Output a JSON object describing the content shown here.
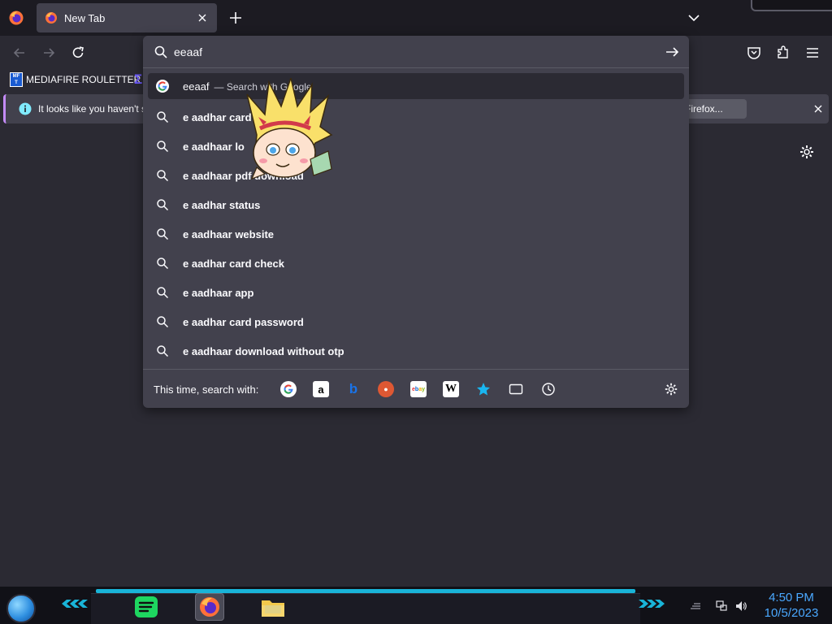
{
  "browser": {
    "tab": {
      "title": "New Tab"
    }
  },
  "bookmarks": {
    "items": [
      {
        "label": "MEDIAFIRE ROULETTER",
        "icon_text": "MF\nT"
      }
    ]
  },
  "notification": {
    "text": "It looks like you haven't s",
    "button_label": "h Firefox..."
  },
  "urlbar": {
    "input_value": "eeaaf",
    "results": [
      {
        "text": "eeaaf",
        "sub": "— Search with Google",
        "icon": "google-icon",
        "selected": true
      },
      {
        "text": "e aadhar card",
        "icon": "search-icon"
      },
      {
        "text": "e aadhaar lo",
        "icon": "search-icon"
      },
      {
        "text": "e aadhaar pdf download",
        "icon": "search-icon"
      },
      {
        "text": "e aadhar status",
        "icon": "search-icon"
      },
      {
        "text": "e aadhaar website",
        "icon": "search-icon"
      },
      {
        "text": "e aadhar card check",
        "icon": "search-icon"
      },
      {
        "text": "e aadhaar app",
        "icon": "search-icon"
      },
      {
        "text": "e aadhar card password",
        "icon": "search-icon"
      },
      {
        "text": "e aadhaar download without otp",
        "icon": "search-icon"
      }
    ],
    "oneoff_label": "This time, search with:",
    "engines": [
      "google-icon",
      "amazon-icon",
      "bing-icon",
      "duckduckgo-icon",
      "ebay-icon",
      "wikipedia-icon",
      "bookmarks-star-icon",
      "tabs-icon",
      "history-icon"
    ]
  },
  "taskbar": {
    "time": "4:50 PM",
    "date": "10/5/2023"
  },
  "colors": {
    "accent_blue": "#4aa8ff",
    "taskbar_glow": "#19b4d8",
    "panel_bg": "#42414d",
    "page_bg": "#2b2a33"
  }
}
